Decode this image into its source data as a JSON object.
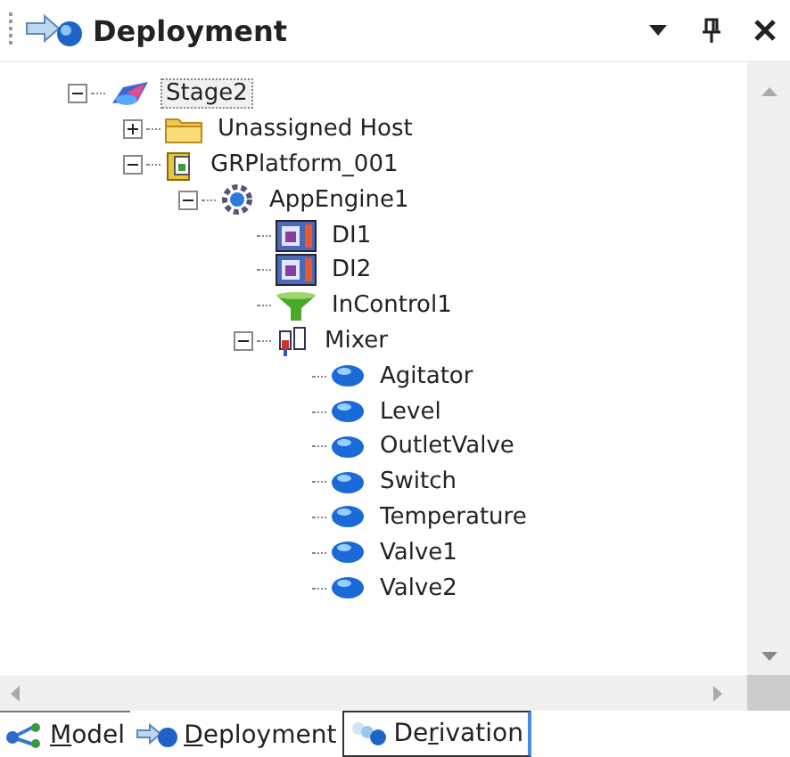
{
  "panel": {
    "title": "Deployment"
  },
  "tree": [
    {
      "label": "Stage2",
      "kind": "galaxy",
      "selected": true,
      "expanded": true,
      "children": [
        {
          "label": "Unassigned Host",
          "kind": "folder",
          "selected": false,
          "expanded": false
        },
        {
          "label": "GRPlatform_001",
          "kind": "platform",
          "selected": false,
          "expanded": true,
          "children": [
            {
              "label": "AppEngine1",
              "kind": "engine",
              "selected": false,
              "expanded": true,
              "children": [
                {
                  "label": "DI1",
                  "kind": "di",
                  "selected": false
                },
                {
                  "label": "DI2",
                  "kind": "di",
                  "selected": false
                },
                {
                  "label": "InControl1",
                  "kind": "funnel",
                  "selected": false
                },
                {
                  "label": "Mixer",
                  "kind": "template",
                  "selected": false,
                  "expanded": true,
                  "children": [
                    {
                      "label": "Agitator",
                      "kind": "ball",
                      "selected": false
                    },
                    {
                      "label": "Level",
                      "kind": "ball",
                      "selected": false
                    },
                    {
                      "label": "OutletValve",
                      "kind": "ball",
                      "selected": false
                    },
                    {
                      "label": "Switch",
                      "kind": "ball",
                      "selected": false
                    },
                    {
                      "label": "Temperature",
                      "kind": "ball",
                      "selected": false
                    },
                    {
                      "label": "Valve1",
                      "kind": "ball",
                      "selected": false
                    },
                    {
                      "label": "Valve2",
                      "kind": "ball",
                      "selected": false
                    }
                  ]
                }
              ]
            }
          ]
        }
      ]
    }
  ],
  "tabs": [
    {
      "kind": "model",
      "key": "M",
      "post": "odel",
      "selected": false,
      "focused": false
    },
    {
      "kind": "deployment",
      "key": "D",
      "post": "eployment",
      "selected": true,
      "focused": false
    },
    {
      "kind": "derivation",
      "pre": "De",
      "key": "r",
      "post": "ivation",
      "selected": false,
      "focused": true
    }
  ]
}
